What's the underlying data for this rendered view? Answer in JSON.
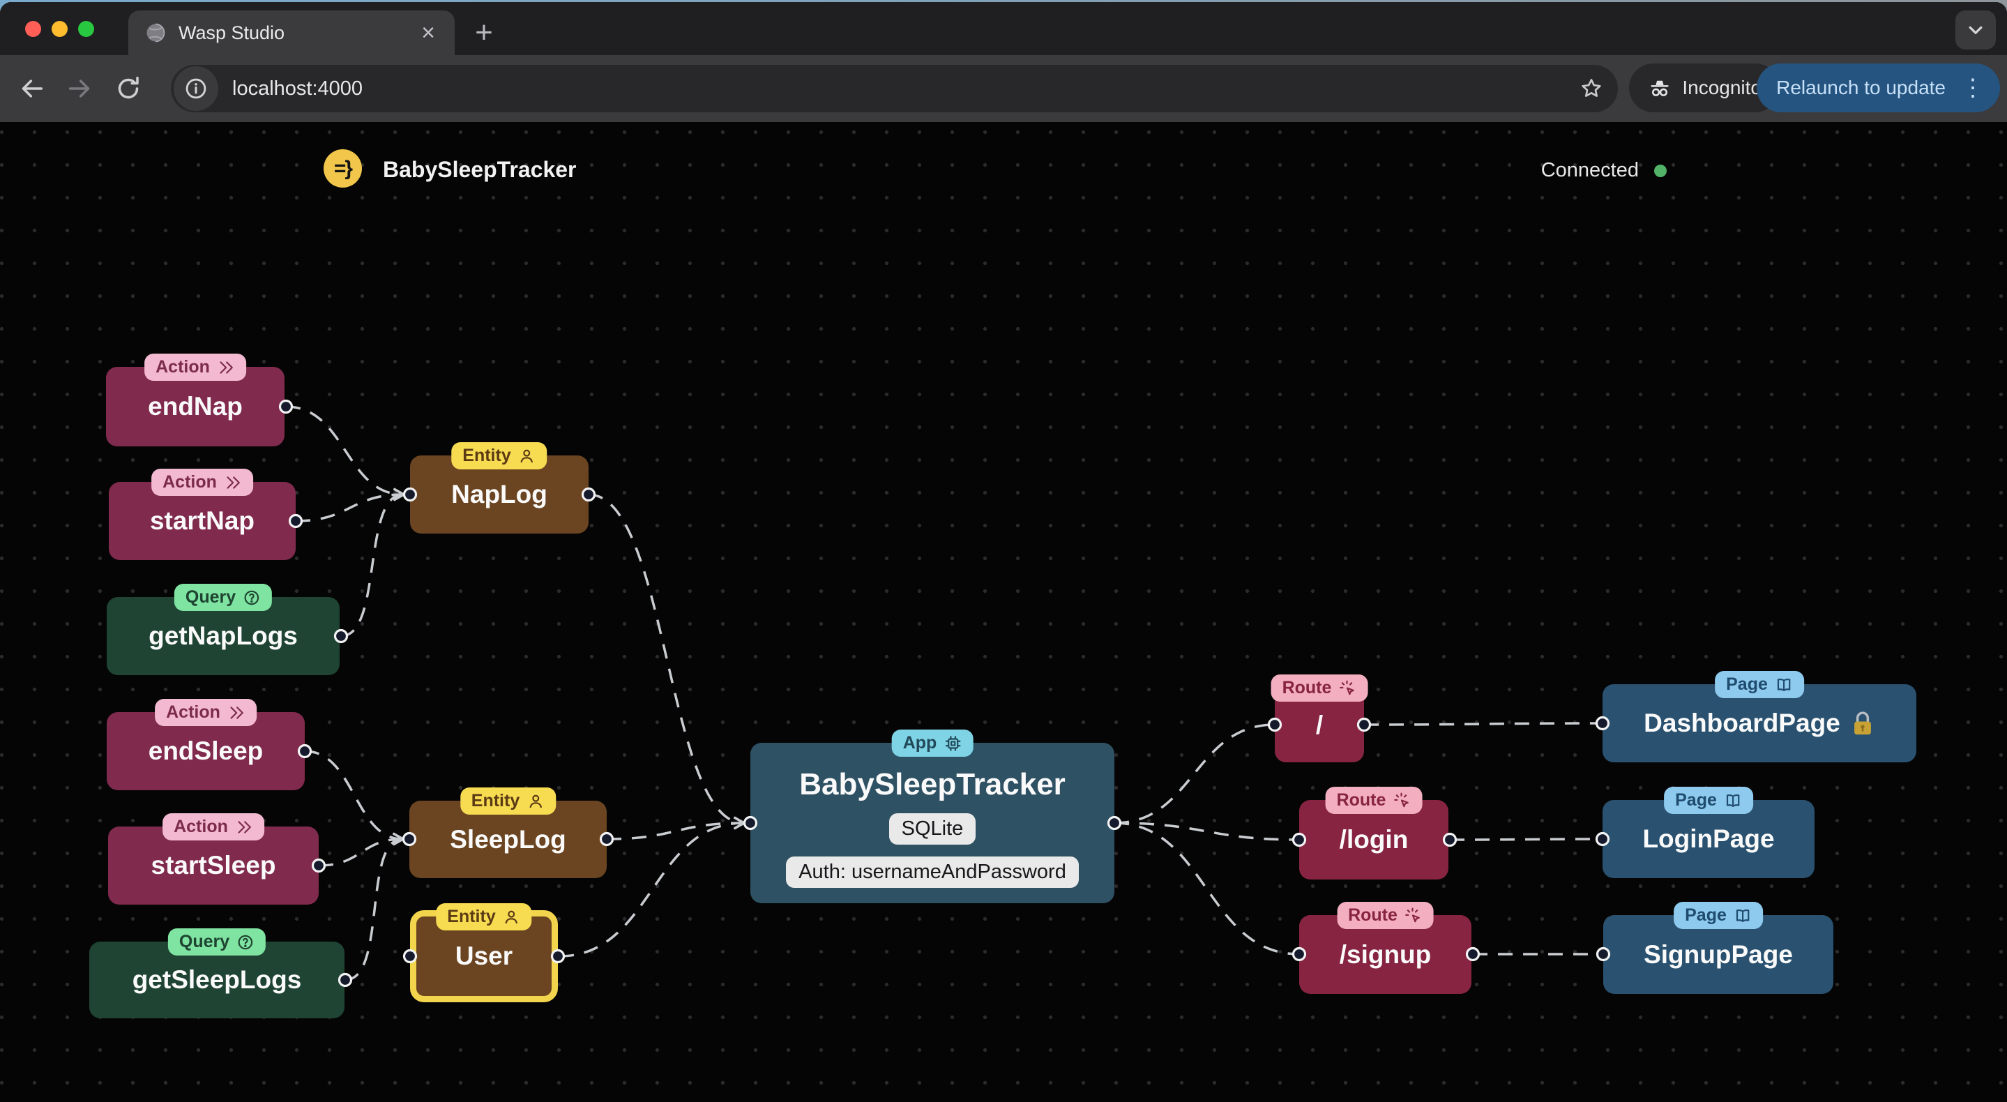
{
  "browser": {
    "tab_title": "Wasp Studio",
    "close_tab_glyph": "×",
    "new_tab_glyph": "+",
    "url": "localhost:4000",
    "incognito_label": "Incognito",
    "relaunch_label": "Relaunch to update",
    "menu_dots_glyph": "⋮"
  },
  "page_header": {
    "logo_glyph": "=}",
    "title": "BabySleepTracker",
    "status": "Connected"
  },
  "icons": {
    "action_badge": "chevron-double-right",
    "query_badge": "question-mark-circle",
    "entity_badge": "user",
    "app_badge": "cpu-chip",
    "route_badge": "cursor-click",
    "page_badge": "open-book",
    "dashboard_lock": "lock",
    "status": "green-dot",
    "favicon": "globe"
  },
  "colors": {
    "action": "#802A4D",
    "action_badge": "#F2B9D1",
    "query": "#1F4433",
    "query_badge": "#7FE3A1",
    "entity": "#6B4521",
    "entity_badge": "#F7DC52",
    "app": "#2E5164",
    "app_badge": "#7ED4E5",
    "route": "#872441",
    "route_badge": "#F3AEC0",
    "page": "#2A5270",
    "page_badge": "#8ECAEE",
    "edge": "#C9CCD1",
    "selected_outline": "#F2D44D",
    "status_connected": "#52B368",
    "relaunch_button": "#255480"
  },
  "graph": {
    "nodes": {
      "endNap": {
        "badge": "Action",
        "label": "endNap"
      },
      "startNap": {
        "badge": "Action",
        "label": "startNap"
      },
      "getNapLogs": {
        "badge": "Query",
        "label": "getNapLogs"
      },
      "endSleep": {
        "badge": "Action",
        "label": "endSleep"
      },
      "startSleep": {
        "badge": "Action",
        "label": "startSleep"
      },
      "getSleepLogs": {
        "badge": "Query",
        "label": "getSleepLogs"
      },
      "napLog": {
        "badge": "Entity",
        "label": "NapLog"
      },
      "sleepLog": {
        "badge": "Entity",
        "label": "SleepLog"
      },
      "user": {
        "badge": "Entity",
        "label": "User"
      },
      "app": {
        "badge": "App",
        "label": "BabySleepTracker",
        "database": "SQLite",
        "auth": "Auth: usernameAndPassword"
      },
      "routeRoot": {
        "badge": "Route",
        "label": "/"
      },
      "routeLogin": {
        "badge": "Route",
        "label": "/login"
      },
      "routeSignup": {
        "badge": "Route",
        "label": "/signup"
      },
      "dashboardPage": {
        "badge": "Page",
        "label": "DashboardPage"
      },
      "loginPage": {
        "badge": "Page",
        "label": "LoginPage"
      },
      "signupPage": {
        "badge": "Page",
        "label": "SignupPage"
      }
    },
    "edges": [
      {
        "from": "endNap",
        "to": "NapLog"
      },
      {
        "from": "startNap",
        "to": "NapLog"
      },
      {
        "from": "getNapLogs",
        "to": "NapLog"
      },
      {
        "from": "endSleep",
        "to": "SleepLog"
      },
      {
        "from": "startSleep",
        "to": "SleepLog"
      },
      {
        "from": "getSleepLogs",
        "to": "SleepLog"
      },
      {
        "from": "NapLog",
        "to": "BabySleepTracker"
      },
      {
        "from": "SleepLog",
        "to": "BabySleepTracker"
      },
      {
        "from": "User",
        "to": "BabySleepTracker"
      },
      {
        "from": "BabySleepTracker",
        "to": "/"
      },
      {
        "from": "BabySleepTracker",
        "to": "/login"
      },
      {
        "from": "BabySleepTracker",
        "to": "/signup"
      },
      {
        "from": "/",
        "to": "DashboardPage"
      },
      {
        "from": "/login",
        "to": "LoginPage"
      },
      {
        "from": "/signup",
        "to": "SignupPage"
      }
    ]
  }
}
